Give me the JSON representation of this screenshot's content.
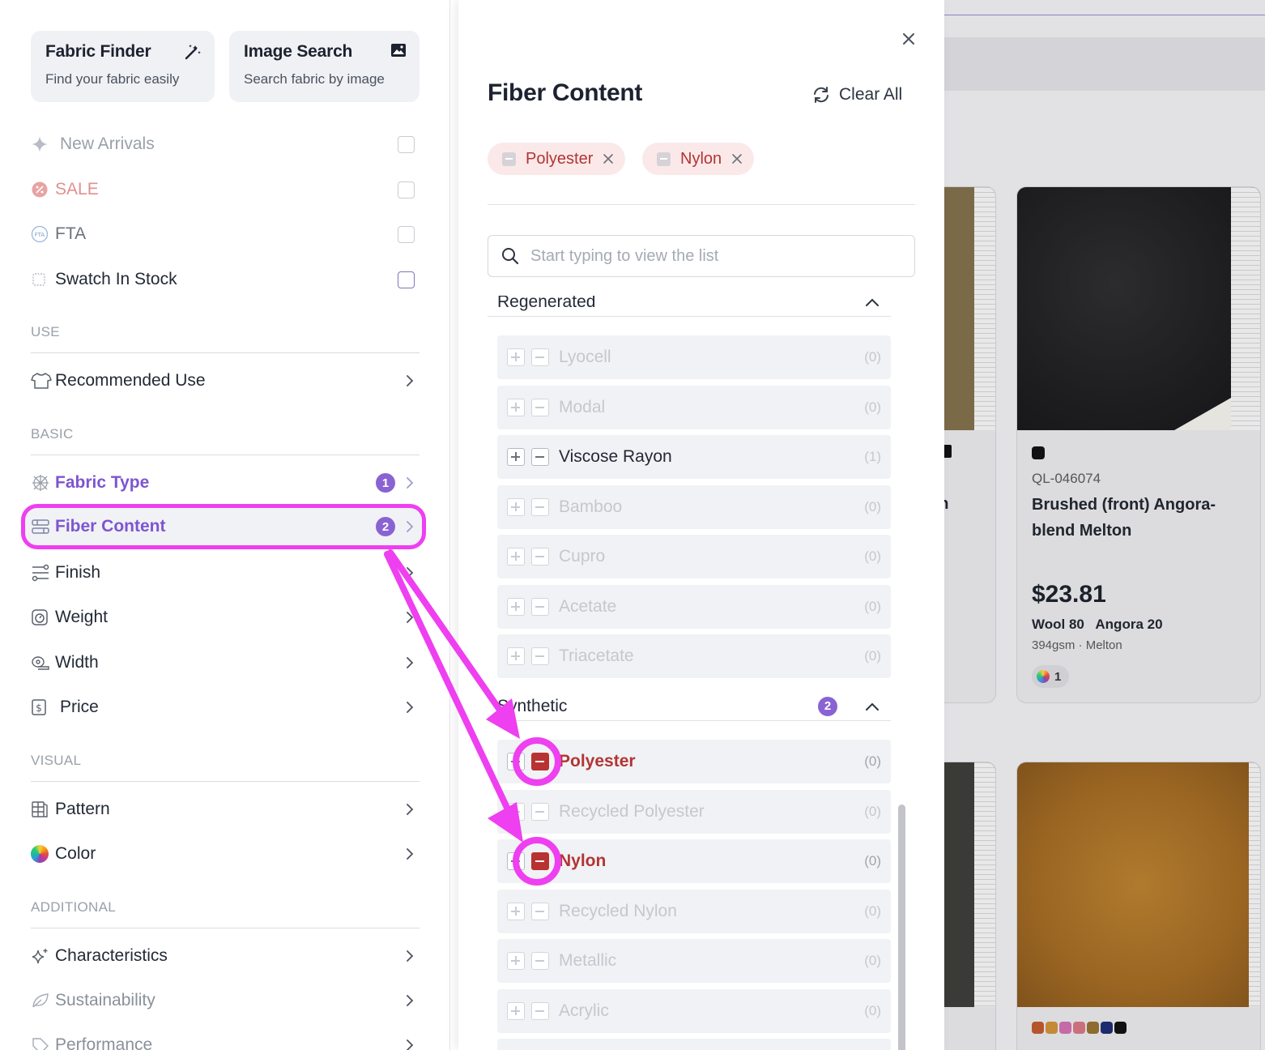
{
  "sidebar": {
    "cards": [
      {
        "title": "Fabric Finder",
        "subtitle": "Find your fabric easily",
        "icon": "magic-wand-icon"
      },
      {
        "title": "Image Search",
        "subtitle": "Search fabric by image",
        "icon": "image-icon"
      }
    ],
    "toggles": [
      {
        "label": "New Arrivals",
        "icon": "sparkle-icon",
        "checked": false
      },
      {
        "label": "SALE",
        "icon": "sale-tag-icon",
        "checked": false
      },
      {
        "label": "FTA",
        "icon": "fta-icon",
        "checked": false
      },
      {
        "label": "Swatch In Stock",
        "icon": "swatch-icon",
        "checked": false
      }
    ],
    "sections": {
      "use": "USE",
      "basic": "BASIC",
      "visual": "VISUAL",
      "additional": "ADDITIONAL"
    },
    "use_items": [
      {
        "label": "Recommended Use",
        "icon": "shirt-icon"
      }
    ],
    "basic_items": [
      {
        "label": "Fabric Type",
        "icon": "weave-icon",
        "badge": "1"
      },
      {
        "label": "Fiber Content",
        "icon": "fiber-icon",
        "badge": "2"
      },
      {
        "label": "Finish",
        "icon": "finish-icon"
      },
      {
        "label": "Weight",
        "icon": "scale-icon"
      },
      {
        "label": "Width",
        "icon": "measure-tape-icon"
      },
      {
        "label": "Price",
        "icon": "dollar-icon"
      }
    ],
    "visual_items": [
      {
        "label": "Pattern",
        "icon": "pattern-icon"
      },
      {
        "label": "Color",
        "icon": "color-wheel-icon"
      }
    ],
    "additional_items": [
      {
        "label": "Characteristics",
        "icon": "sparkles-icon"
      },
      {
        "label": "Sustainability",
        "icon": "leaf-icon"
      },
      {
        "label": "Performance",
        "icon": "tag-icon"
      }
    ]
  },
  "modal": {
    "title": "Fiber Content",
    "clear_all": "Clear All",
    "chips": [
      {
        "label": "Polyester"
      },
      {
        "label": "Nylon"
      }
    ],
    "search_placeholder": "Start typing to view the list",
    "groups": [
      {
        "name": "Regenerated",
        "badge": "",
        "items": [
          {
            "name": "Lyocell",
            "count": "(0)",
            "state": "disabled"
          },
          {
            "name": "Modal",
            "count": "(0)",
            "state": "disabled"
          },
          {
            "name": "Viscose Rayon",
            "count": "(1)",
            "state": "normal"
          },
          {
            "name": "Bamboo",
            "count": "(0)",
            "state": "disabled"
          },
          {
            "name": "Cupro",
            "count": "(0)",
            "state": "disabled"
          },
          {
            "name": "Acetate",
            "count": "(0)",
            "state": "disabled"
          },
          {
            "name": "Triacetate",
            "count": "(0)",
            "state": "disabled"
          }
        ]
      },
      {
        "name": "Synthetic",
        "badge": "2",
        "items": [
          {
            "name": "Polyester",
            "count": "(0)",
            "state": "excluded"
          },
          {
            "name": "Recycled Polyester",
            "count": "(0)",
            "state": "disabled"
          },
          {
            "name": "Nylon",
            "count": "(0)",
            "state": "excluded"
          },
          {
            "name": "Recycled Nylon",
            "count": "(0)",
            "state": "disabled"
          },
          {
            "name": "Metallic",
            "count": "(0)",
            "state": "disabled"
          },
          {
            "name": "Acrylic",
            "count": "(0)",
            "state": "disabled"
          }
        ]
      }
    ]
  },
  "products": [
    {
      "partial_text": "on"
    },
    {
      "sku": "QL-046074",
      "name": "Brushed (front) Angora-blend Melton",
      "price": "$23.81",
      "composition": "Wool 80   Angora 20",
      "meta": "394gsm · Melton",
      "color_count": "1"
    }
  ],
  "colors": {
    "accent": "#8a63d2",
    "excluded": "#b83232",
    "chip_bg": "#fbe9e9",
    "annotation": "#ee3ff0"
  }
}
